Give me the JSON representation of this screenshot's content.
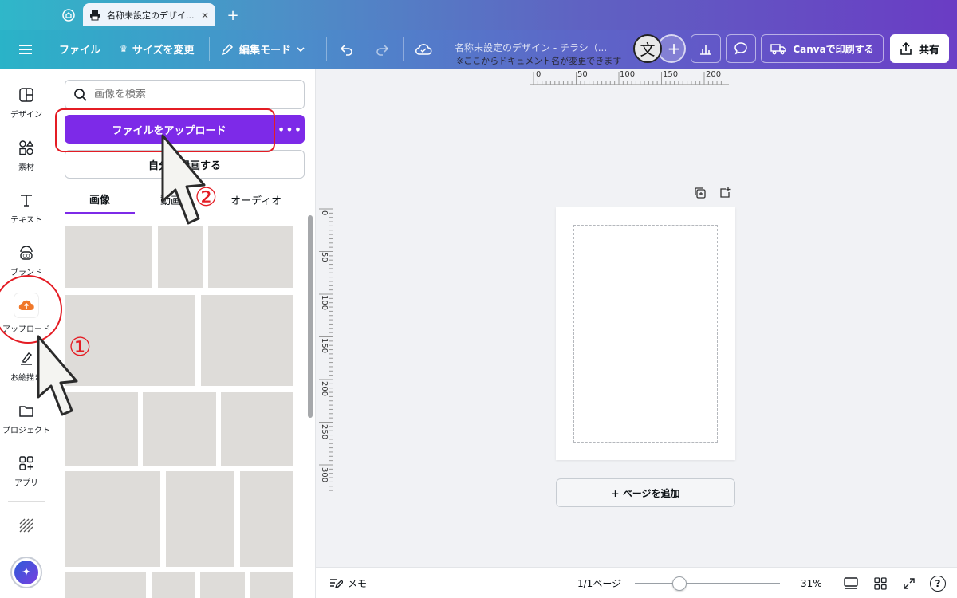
{
  "browser": {
    "tab_title": "名称未設定のデザイ...",
    "tab_close": "×",
    "new_tab": "+"
  },
  "header": {
    "menu_icon": "hamburger-icon",
    "file": "ファイル",
    "resize": "サイズを変更",
    "edit_mode": "編集モード",
    "doc_title": "名称未設定のデザイン - チラシ（...",
    "doc_note": "※ここからドキュメント名が変更できます",
    "translate_glyph": "文",
    "print": "Canvaで印刷する",
    "share": "共有"
  },
  "rail": {
    "items": [
      {
        "label": "デザイン",
        "icon": "layout-icon"
      },
      {
        "label": "素材",
        "icon": "shapes-icon"
      },
      {
        "label": "テキスト",
        "icon": "text-icon"
      },
      {
        "label": "ブランド",
        "icon": "brand-icon"
      },
      {
        "label": "アップロード",
        "icon": "cloud-upload-icon"
      },
      {
        "label": "お絵描き",
        "icon": "draw-icon"
      },
      {
        "label": "プロジェクト",
        "icon": "folder-icon"
      },
      {
        "label": "アプリ",
        "icon": "apps-icon"
      }
    ]
  },
  "panel": {
    "search_placeholder": "画像を検索",
    "upload_button": "ファイルをアップロード",
    "more": "•••",
    "record_button": "自分を録画する",
    "tabs": [
      {
        "label": "画像",
        "active": true
      },
      {
        "label": "動画",
        "active": false
      },
      {
        "label": "オーディオ",
        "active": false
      }
    ]
  },
  "canvas": {
    "ruler_h": [
      "0",
      "50",
      "100",
      "150",
      "200"
    ],
    "ruler_v": [
      "0",
      "50",
      "100",
      "150",
      "200",
      "250",
      "300"
    ],
    "add_page": "+ ページを追加"
  },
  "footer": {
    "notes": "メモ",
    "page_count": "1/1ページ",
    "zoom": "31%",
    "zoom_fraction": 0.31,
    "help": "?"
  },
  "annotations": {
    "step1": "①",
    "step2": "②"
  },
  "colors": {
    "accent": "#7d2ae8",
    "upload_icon": "#f0782a",
    "annotation": "#e41c24"
  }
}
